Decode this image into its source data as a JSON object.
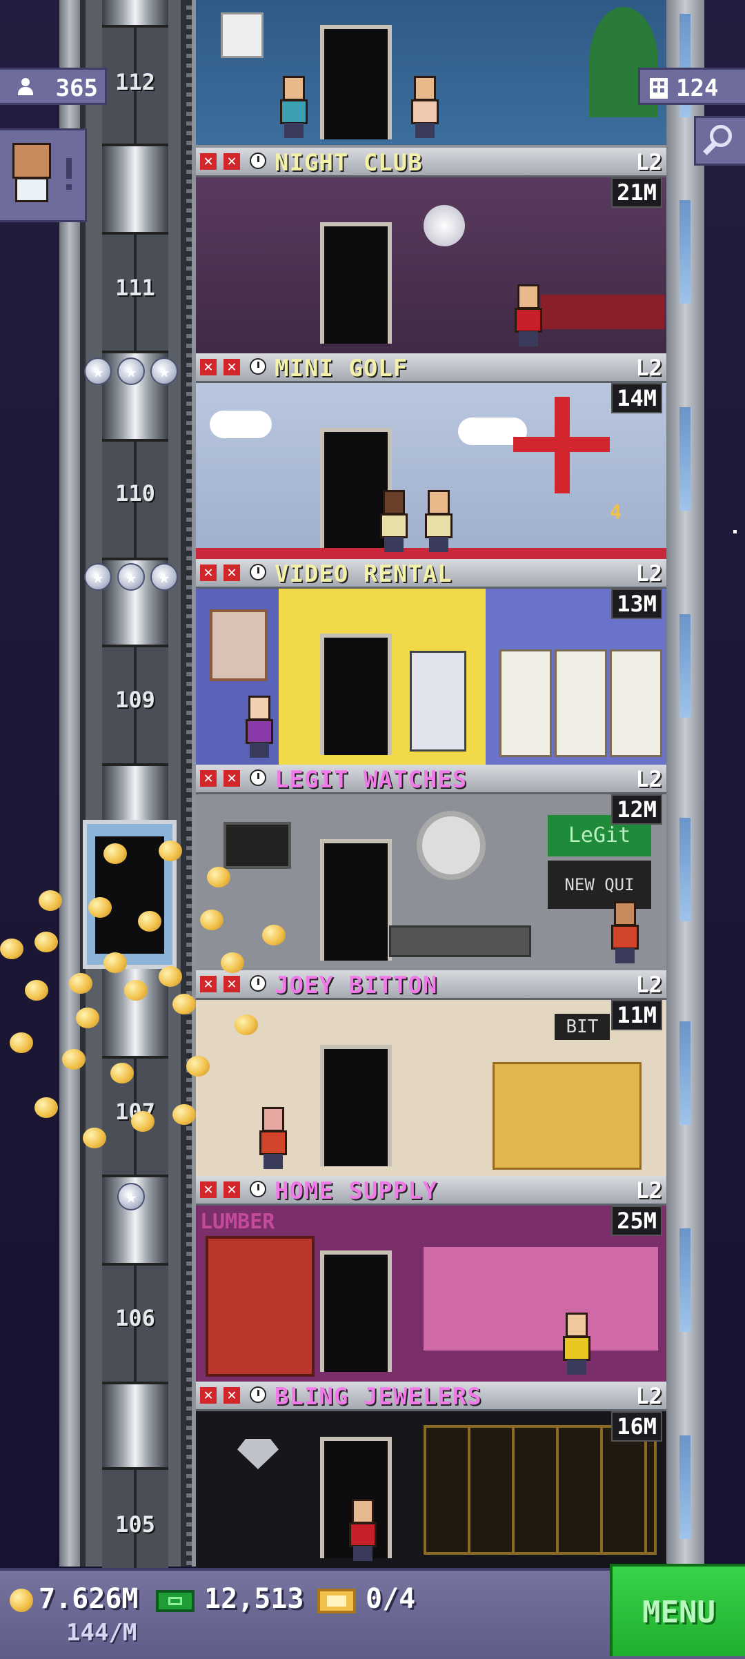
{
  "hud": {
    "population": "365",
    "floors": "124",
    "coins": "7.626M",
    "coin_rate": "144/M",
    "bux": "12,513",
    "tickets": "0/4",
    "menu_label": "MENU"
  },
  "floor_numbers": [
    "112",
    "111",
    "110",
    "109",
    "107",
    "106",
    "105"
  ],
  "rooms": [
    {
      "name": "NIGHT CLUB",
      "level": "L2",
      "stock": "21M",
      "name_color": "#f3f0a8",
      "stars": 0
    },
    {
      "name": "MINI GOLF",
      "level": "L2",
      "stock": "14M",
      "name_color": "#f3f0a8",
      "stars": 3
    },
    {
      "name": "VIDEO RENTAL",
      "level": "L2",
      "stock": "13M",
      "name_color": "#f3f0a8",
      "stars": 3
    },
    {
      "name": "LEGIT WATCHES",
      "level": "L2",
      "stock": "12M",
      "name_color": "#f07be8",
      "stars": 0
    },
    {
      "name": "JOEY BITTON",
      "level": "L2",
      "stock": "11M",
      "name_color": "#f07be8",
      "stars": 0
    },
    {
      "name": "HOME SUPPLY",
      "level": "L2",
      "stock": "25M",
      "name_color": "#f07be8",
      "stars": 1
    },
    {
      "name": "BLING JEWELERS",
      "level": "L2",
      "stock": "16M",
      "name_color": "#f07be8",
      "stars": 0
    }
  ],
  "room_signage": {
    "watch_sign": "LeGit",
    "watch_sign_2": "NEW QUI",
    "bitton_sign": "BIT",
    "lumber_sign": "LUMBER",
    "golf_hole": "4"
  },
  "colors": {
    "accent_green": "#1fae2d",
    "hud_purple": "#6e6c9c",
    "category_yellow": "#f3f0a8",
    "category_pink": "#f07be8"
  }
}
